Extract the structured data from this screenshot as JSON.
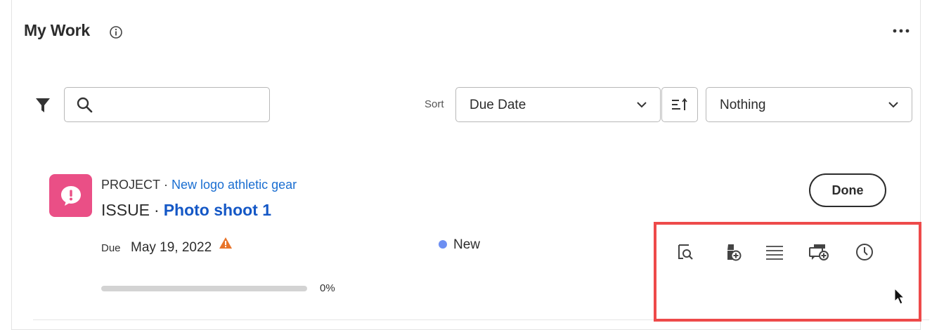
{
  "widget": {
    "title": "My Work"
  },
  "toolbar": {
    "search_placeholder": "",
    "search_value": "",
    "sort_label": "Sort",
    "sort_by": "Due Date",
    "group_by": "Nothing"
  },
  "work_item": {
    "project_prefix": "PROJECT",
    "project_name": "New logo athletic gear",
    "issue_prefix": "ISSUE",
    "issue_name": "Photo shoot 1",
    "due_label": "Due",
    "due_date": "May 19, 2022",
    "status": "New",
    "progress_percent": 0,
    "progress_text": "0%",
    "done_label": "Done"
  },
  "colors": {
    "project_avatar": "#ea4f86",
    "link_blue": "#1a6ed1",
    "status_new": "#6d8ff2",
    "warning": "#e8742a",
    "highlight": "#ee4a4a"
  },
  "icons": {
    "actions": [
      "preview-icon",
      "add-document-icon",
      "details-list-icon",
      "add-update-icon",
      "log-time-icon"
    ]
  }
}
